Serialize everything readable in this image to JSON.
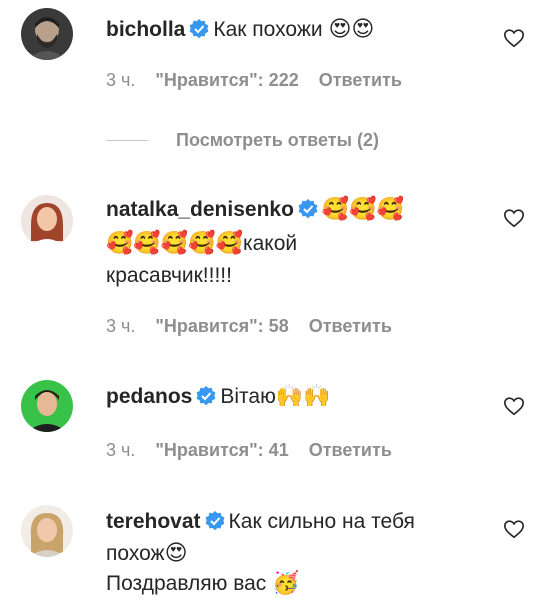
{
  "comments": [
    {
      "username": "bicholla",
      "text_line1": "Как похожи",
      "emojis_line1": "😍😍",
      "time": "3 ч.",
      "likes": "\"Нравится\": 222",
      "reply": "Ответить",
      "avatar_icon": "avatar-man-beard-icon"
    },
    {
      "username": "natalka_denisenko",
      "emojis_line1": "🥰🥰🥰",
      "emojis_line2": "🥰🥰🥰🥰🥰",
      "text_line2": "какой",
      "text_line3": "красавчик!!!!!",
      "time": "3 ч.",
      "likes": "\"Нравится\": 58",
      "reply": "Ответить",
      "avatar_icon": "avatar-woman-red-hair-icon"
    },
    {
      "username": "pedanos",
      "text_line1": "Вітаю",
      "emojis_line1": "🙌🙌",
      "time": "3 ч.",
      "likes": "\"Нравится\": 41",
      "reply": "Ответить",
      "avatar_icon": "avatar-man-green-background-icon"
    },
    {
      "username": "terehovat",
      "text_line1": "Как сильно на тебя",
      "text_line2": "похож",
      "emojis_line2": "😍",
      "text_line3": "Поздравляю вас",
      "emojis_line3": "🥳",
      "avatar_icon": "avatar-woman-blonde-icon"
    }
  ],
  "view_replies": "Посмотреть ответы (2)",
  "colors": {
    "text": "#262626",
    "secondary": "#8e8e8e",
    "verified": "#3897f0"
  }
}
